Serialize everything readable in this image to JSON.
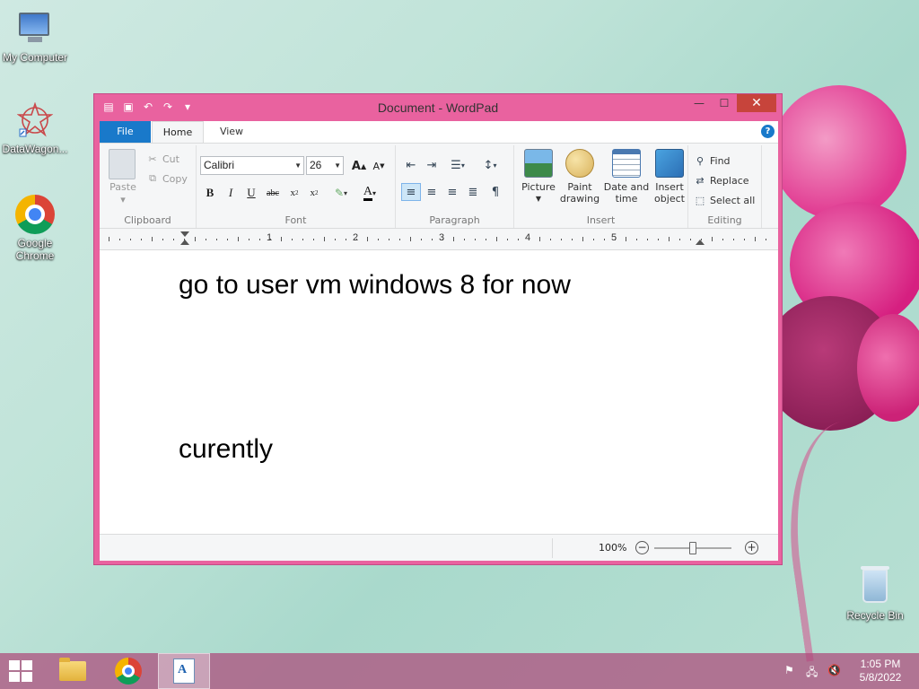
{
  "desktop": {
    "icons": [
      {
        "label": "My Computer"
      },
      {
        "label": "DataWagon..."
      },
      {
        "label": "Google Chrome"
      },
      {
        "label": "Recycle Bin"
      }
    ]
  },
  "window": {
    "title": "Document - WordPad",
    "tabs": {
      "file": "File",
      "home": "Home",
      "view": "View"
    },
    "clipboard": {
      "group_label": "Clipboard",
      "paste": "Paste",
      "cut": "Cut",
      "copy": "Copy"
    },
    "font": {
      "group_label": "Font",
      "family": "Calibri",
      "size": "26"
    },
    "paragraph": {
      "group_label": "Paragraph"
    },
    "insert": {
      "group_label": "Insert",
      "picture": "Picture",
      "paint_drawing_1": "Paint",
      "paint_drawing_2": "drawing",
      "date_time_1": "Date and",
      "date_time_2": "time",
      "insert_object_1": "Insert",
      "insert_object_2": "object"
    },
    "editing": {
      "group_label": "Editing",
      "find": "Find",
      "replace": "Replace",
      "select_all": "Select all"
    },
    "ruler": {
      "numbers": [
        "1",
        "2",
        "3",
        "4",
        "5"
      ]
    },
    "document": {
      "lines": [
        "go to user vm windows 8 for now",
        "curently"
      ]
    },
    "status": {
      "zoom": "100%"
    }
  },
  "taskbar": {
    "clock_time": "1:05 PM",
    "clock_date": "5/8/2022"
  }
}
